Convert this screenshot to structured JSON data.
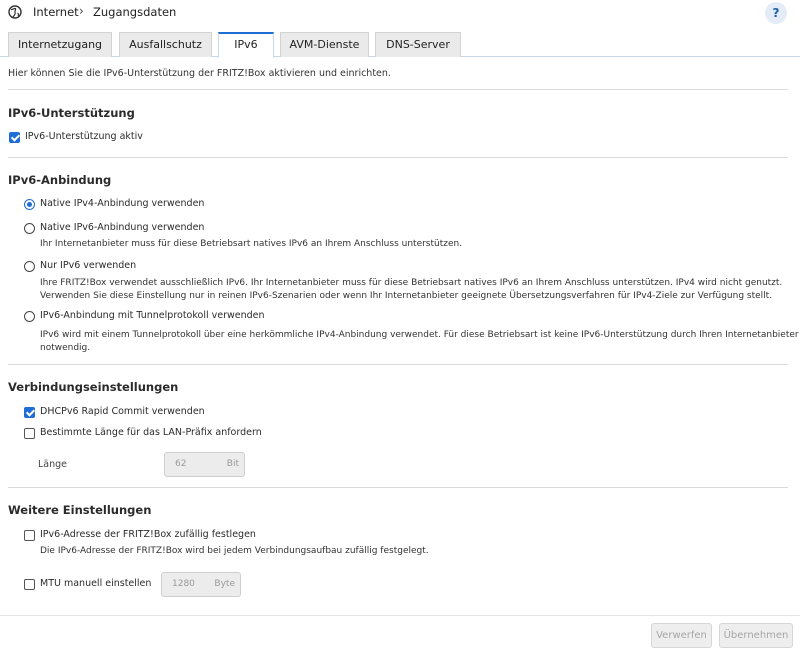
{
  "header": {
    "breadcrumb_root": "Internet",
    "breadcrumb_sep": "›",
    "breadcrumb_page": "Zugangsdaten",
    "help_label": "?"
  },
  "tabs": [
    {
      "label": "Internetzugang",
      "active": false
    },
    {
      "label": "Ausfallschutz",
      "active": false
    },
    {
      "label": "IPv6",
      "active": true
    },
    {
      "label": "AVM-Dienste",
      "active": false
    },
    {
      "label": "DNS-Server",
      "active": false
    }
  ],
  "intro": "Hier können Sie die IPv6-Unterstützung der FRITZ!Box aktivieren und einrichten.",
  "support": {
    "title": "IPv6-Unterstützung",
    "checkbox_label": "IPv6-Unterstützung aktiv",
    "checked": true
  },
  "connection": {
    "title": "IPv6-Anbindung",
    "options": [
      {
        "label": "Native IPv4-Anbindung verwenden",
        "selected": true,
        "desc": ""
      },
      {
        "label": "Native IPv6-Anbindung verwenden",
        "selected": false,
        "desc": "Ihr Internetanbieter muss für diese Betriebsart natives IPv6 an Ihrem Anschluss unterstützen."
      },
      {
        "label": "Nur IPv6 verwenden",
        "selected": false,
        "desc1": "Ihre FRITZ!Box verwendet ausschließlich IPv6. Ihr Internetanbieter muss für diese Betriebsart natives IPv6 an Ihrem Anschluss unterstützen. IPv4 wird nicht genutzt.",
        "desc2": "Verwenden Sie diese Einstellung nur in reinen IPv6-Szenarien oder wenn Ihr Internetanbieter geeignete Übersetzungsverfahren für IPv4-Ziele zur Verfügung stellt."
      },
      {
        "label": "IPv6-Anbindung mit Tunnelprotokoll verwenden",
        "selected": false,
        "desc1": "IPv6 wird mit einem Tunnelprotokoll über eine herkömmliche IPv4-Anbindung verwendet. Für diese Betriebsart ist keine IPv6-Unterstützung durch Ihren Internetanbieter",
        "desc2": "notwendig."
      }
    ]
  },
  "settings": {
    "title": "Verbindungseinstellungen",
    "dhcp_label": "DHCPv6 Rapid Commit verwenden",
    "dhcp_checked": true,
    "prefix_label": "Bestimmte Länge für das LAN-Präfix anfordern",
    "prefix_checked": false,
    "length_label": "Länge",
    "length_value": "62",
    "length_unit": "Bit"
  },
  "further": {
    "title": "Weitere Einstellungen",
    "random_label": "IPv6-Adresse der FRITZ!Box zufällig festlegen",
    "random_checked": false,
    "random_desc": "Die IPv6-Adresse der FRITZ!Box wird bei jedem Verbindungsaufbau zufällig festgelegt.",
    "mtu_label": "MTU manuell einstellen",
    "mtu_checked": false,
    "mtu_value": "1280",
    "mtu_unit": "Byte"
  },
  "footer": {
    "discard_label": "Verwerfen",
    "apply_label": "Übernehmen"
  },
  "colors": {
    "accent": "#1e6ed6",
    "disabled_bg": "#eeeeee"
  }
}
